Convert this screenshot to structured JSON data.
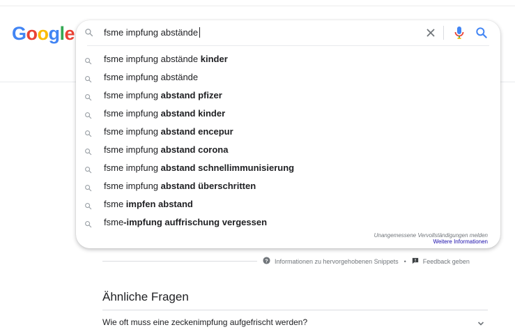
{
  "logo": {
    "letters": [
      {
        "char": "G",
        "color": "#4285F4"
      },
      {
        "char": "o",
        "color": "#EA4335"
      },
      {
        "char": "o",
        "color": "#FBBC05"
      },
      {
        "char": "g",
        "color": "#4285F4"
      },
      {
        "char": "l",
        "color": "#34A853"
      },
      {
        "char": "e",
        "color": "#EA4335"
      }
    ]
  },
  "search": {
    "query": "fsme impfung abstände",
    "icons": {
      "left": "search-icon",
      "clear": "close-icon",
      "voice": "mic-icon",
      "submit": "search-icon"
    }
  },
  "suggestions": [
    {
      "plain": "fsme impfung abstände ",
      "bold": "kinder",
      "tail": ""
    },
    {
      "plain": "fsme impfung abstände",
      "bold": "",
      "tail": ""
    },
    {
      "plain": "fsme impfung ",
      "bold": "abstand pfizer",
      "tail": ""
    },
    {
      "plain": "fsme impfung ",
      "bold": "abstand kinder",
      "tail": ""
    },
    {
      "plain": "fsme impfung ",
      "bold": "abstand encepur",
      "tail": ""
    },
    {
      "plain": "fsme impfung ",
      "bold": "abstand corona",
      "tail": ""
    },
    {
      "plain": "fsme impfung ",
      "bold": "abstand schnellimmunisierung",
      "tail": ""
    },
    {
      "plain": "fsme impfung ",
      "bold": "abstand überschritten",
      "tail": ""
    },
    {
      "plain": "fsme ",
      "bold": "impfen abstand",
      "tail": ""
    },
    {
      "plain": "fsme",
      "bold": "-impfung auffrischung vergessen",
      "tail": ""
    }
  ],
  "autocomplete_footer": {
    "report": "Unangemessene Vervollständigungen melden",
    "more_info": "Weitere Informationen"
  },
  "snippet_bar": {
    "info_label": "Informationen zu hervorgehobenen Snippets",
    "separator": "•",
    "feedback_label": "Feedback geben"
  },
  "related_questions": {
    "title": "Ähnliche Fragen",
    "items": [
      "Wie oft muss eine zeckenimpfung aufgefrischt werden?"
    ]
  },
  "colors": {
    "link": "#1a0dab",
    "muted": "#70757a",
    "icon_blue": "#4285F4",
    "mic_red": "#EA4335"
  }
}
